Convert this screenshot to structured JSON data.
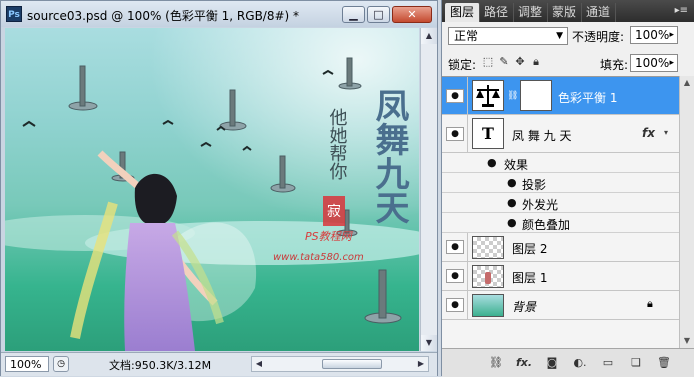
{
  "document": {
    "title": "source03.psd @ 100% (色彩平衡 1, RGB/8#) *",
    "ps_logo": "Ps",
    "window_buttons": {
      "minimize": "▁",
      "maximize": "□",
      "close": "✕"
    },
    "status": {
      "zoom": "100%",
      "doc_size": "文档:950.3K/3.12M"
    },
    "canvas": {
      "title_text": "凤舞九天",
      "poem_text": "他她帮你",
      "seal_text": "寂",
      "watermark_line1": "PS教程网",
      "watermark_line2": "www.tata580.com"
    }
  },
  "panel": {
    "tabs": [
      {
        "label": "图层"
      },
      {
        "label": "路径"
      },
      {
        "label": "调整"
      },
      {
        "label": "蒙版"
      },
      {
        "label": "通道"
      }
    ],
    "tab_menu_icon": "▸≡",
    "blend_mode": "正常",
    "opacity_label": "不透明度:",
    "opacity_value": "100%",
    "lock_label": "锁定:",
    "lock_icons": [
      "lock-transparent-icon",
      "lock-image-icon",
      "lock-position-icon",
      "lock-all-icon"
    ],
    "fill_label": "填充:",
    "fill_value": "100%",
    "layers": [
      {
        "name": "色彩平衡 1",
        "type": "adjustment",
        "selected": true
      },
      {
        "name": "凤 舞 九 天",
        "type": "text",
        "fx": "fx",
        "thumb_letter": "T"
      },
      {
        "name": "图层 2",
        "type": "pixel"
      },
      {
        "name": "图层 1",
        "type": "pixel"
      },
      {
        "name": "背景",
        "type": "background",
        "locked": true
      }
    ],
    "effects": {
      "label": "效果",
      "items": [
        "投影",
        "外发光",
        "颜色叠加"
      ]
    },
    "footer_icons": [
      "link-layers-icon",
      "fx-icon",
      "add-mask-icon",
      "adjustment-layer-icon",
      "new-group-icon",
      "new-layer-icon",
      "delete-layer-icon"
    ],
    "footer_glyphs": {
      "link": "⛓",
      "fx": "fx.",
      "mask": "◙",
      "adjust": "◐.",
      "group": "▭",
      "new": "❏",
      "delete": "🗑"
    }
  },
  "colors": {
    "selection": "#3d95ef",
    "tab_bar": "#3a3a3a",
    "sky_top": "#a9dde0",
    "water": "#36b48e"
  }
}
